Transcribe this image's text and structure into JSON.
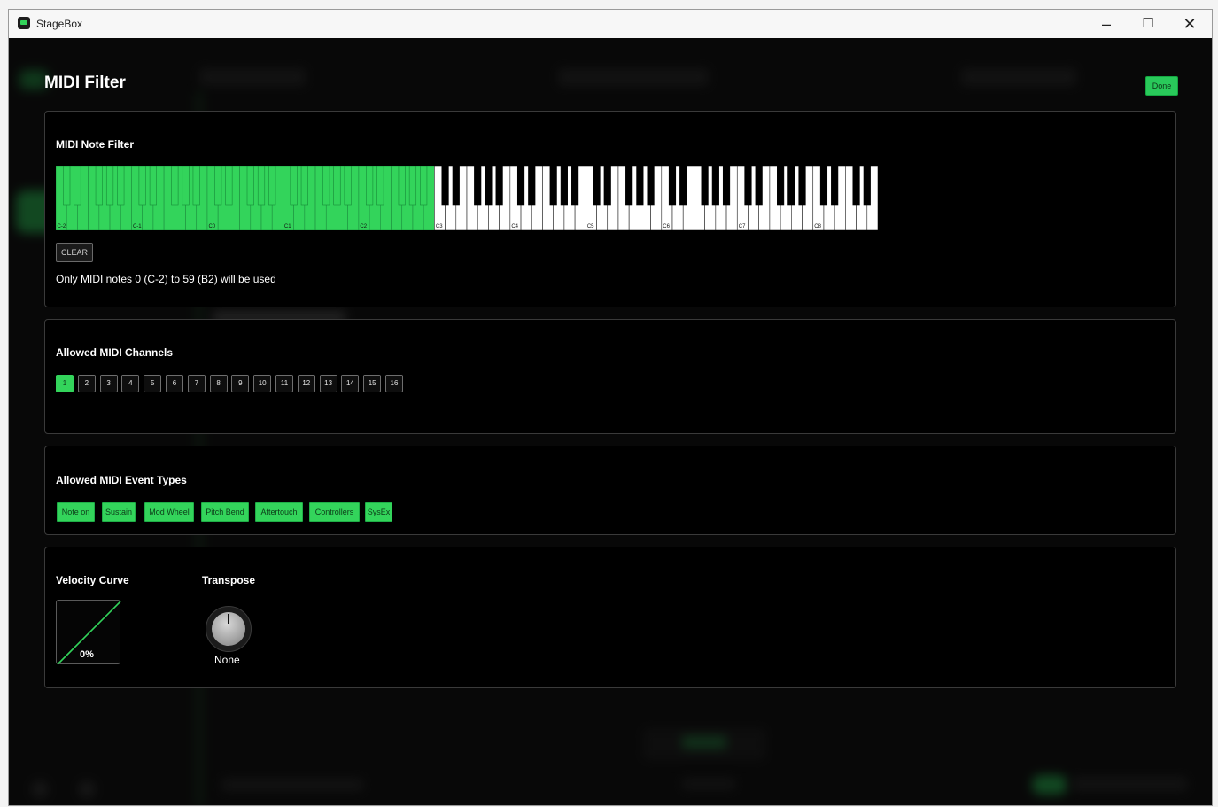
{
  "window": {
    "app_title": "StageBox",
    "minimize_glyph": "–",
    "maximize_glyph": "☐",
    "close_glyph": "✕"
  },
  "dialog": {
    "title": "MIDI Filter",
    "done_label": "Done"
  },
  "note_filter": {
    "title": "MIDI Note Filter",
    "octave_labels": [
      "C-2",
      "C-1",
      "C0",
      "C1",
      "C2",
      "C3",
      "C4",
      "C5",
      "C6",
      "C7",
      "C8"
    ],
    "selected_low": 0,
    "selected_high": 59,
    "clear_label": "CLEAR",
    "info": "Only MIDI notes 0 (C-2) to 59 (B2) will be used"
  },
  "channels": {
    "title": "Allowed MIDI Channels",
    "items": [
      {
        "label": "1",
        "on": true
      },
      {
        "label": "2",
        "on": false
      },
      {
        "label": "3",
        "on": false
      },
      {
        "label": "4",
        "on": false
      },
      {
        "label": "5",
        "on": false
      },
      {
        "label": "6",
        "on": false
      },
      {
        "label": "7",
        "on": false
      },
      {
        "label": "8",
        "on": false
      },
      {
        "label": "9",
        "on": false
      },
      {
        "label": "10",
        "on": false
      },
      {
        "label": "11",
        "on": false
      },
      {
        "label": "12",
        "on": false
      },
      {
        "label": "13",
        "on": false
      },
      {
        "label": "14",
        "on": false
      },
      {
        "label": "15",
        "on": false
      },
      {
        "label": "16",
        "on": false
      }
    ]
  },
  "events": {
    "title": "Allowed MIDI Event Types",
    "items": [
      {
        "label": "Note on",
        "on": true
      },
      {
        "label": "Sustain",
        "on": true
      },
      {
        "label": "Mod Wheel",
        "on": true
      },
      {
        "label": "Pitch Bend",
        "on": true
      },
      {
        "label": "Aftertouch",
        "on": true
      },
      {
        "label": "Controllers",
        "on": true
      },
      {
        "label": "SysEx",
        "on": true
      }
    ]
  },
  "velocity": {
    "title": "Velocity Curve",
    "value_label": "0%"
  },
  "transpose": {
    "title": "Transpose",
    "value_label": "None"
  },
  "colors": {
    "accent": "#33d45b",
    "panel_bg": "#000000",
    "panel_border": "#3a3a3a"
  }
}
